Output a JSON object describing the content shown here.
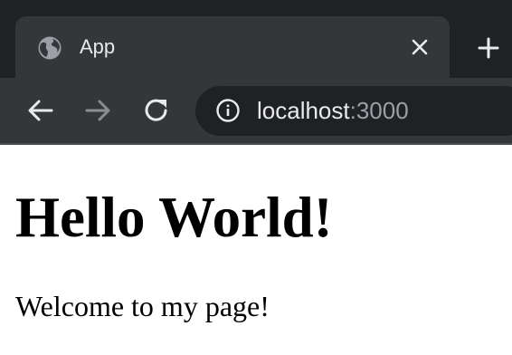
{
  "browser": {
    "tab": {
      "title": "App",
      "favicon": "globe-icon",
      "close_icon": "close-icon"
    },
    "new_tab_icon": "plus-icon",
    "toolbar": {
      "back_icon": "arrow-left-icon",
      "forward_icon": "arrow-right-icon",
      "reload_icon": "reload-icon"
    },
    "address_bar": {
      "info_icon": "info-icon",
      "host": "localhost",
      "port": ":3000"
    },
    "colors": {
      "frame": "#202124",
      "tab": "#35363a",
      "text": "#e8eaed",
      "muted_text": "#9aa0a6"
    }
  },
  "page": {
    "heading": "Hello World!",
    "paragraph": "Welcome to my page!"
  }
}
